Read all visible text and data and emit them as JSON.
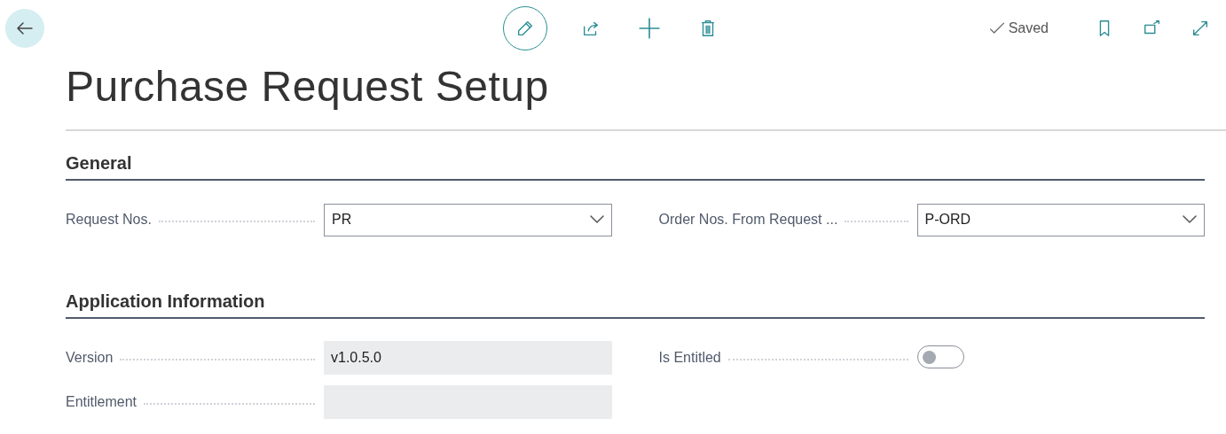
{
  "toolbar": {
    "status": "Saved"
  },
  "page_title": "Purchase Request Setup",
  "sections": [
    {
      "title": "General",
      "fields": [
        {
          "kind": "dropdown",
          "label": "Request Nos.",
          "value": "PR"
        },
        {
          "kind": "dropdown",
          "label": "Order Nos. From Request ...",
          "value": "P-ORD"
        }
      ]
    },
    {
      "title": "Application Information",
      "fields": [
        {
          "kind": "readonly",
          "label": "Version",
          "value": "v1.0.5.0"
        },
        {
          "kind": "toggle",
          "label": "Is Entitled",
          "on": false
        },
        {
          "kind": "readonly",
          "label": "Entitlement"
        }
      ]
    }
  ]
}
